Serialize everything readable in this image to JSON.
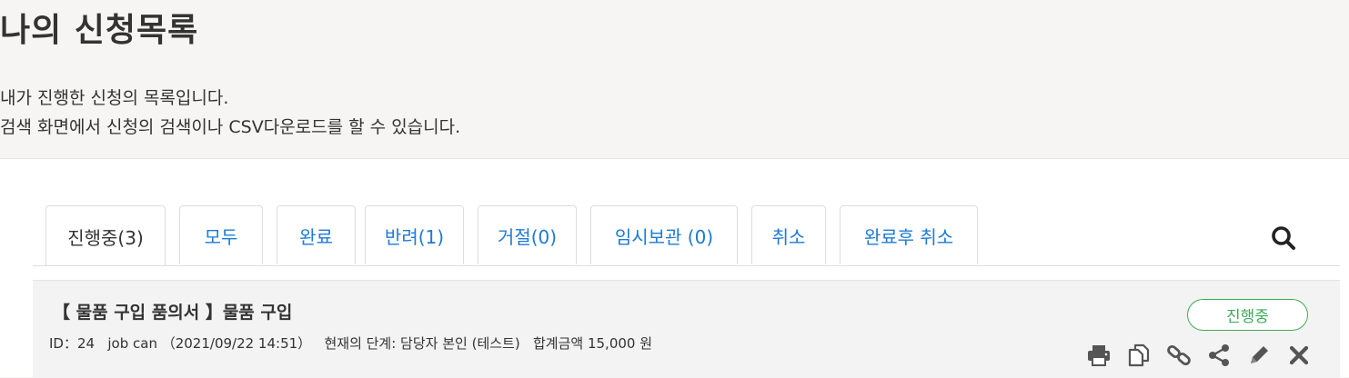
{
  "header": {
    "title": "나의 신청목록",
    "description_line1": "내가 진행한 신청의 목록입니다.",
    "description_line2": "검색 화면에서 신청의 검색이나 CSV다운로드를 할 수 있습니다."
  },
  "tabs": [
    {
      "label": "진행중(3)",
      "active": true
    },
    {
      "label": "모두",
      "active": false
    },
    {
      "label": "완료",
      "active": false
    },
    {
      "label": "반려(1)",
      "active": false
    },
    {
      "label": "거절(0)",
      "active": false
    },
    {
      "label": "임시보관 (0)",
      "active": false
    },
    {
      "label": "취소",
      "active": false
    },
    {
      "label": "완료후 취소",
      "active": false
    }
  ],
  "search": {
    "icon": "search-icon"
  },
  "requests": [
    {
      "title": "【 물품 구입 품의서 】물품 구입",
      "meta": "ID：24   job can （2021/09/22 14:51）   현재의 단계: 담당자 본인 (테스트)   합계금액 15,000 원",
      "status": "진행중"
    }
  ],
  "row_actions": [
    "print-icon",
    "copy-icon",
    "link-icon",
    "share-icon",
    "edit-icon",
    "delete-icon"
  ],
  "colors": {
    "accent": "#1e7ad6",
    "status_green": "#3dab5a",
    "text": "#333333",
    "background": "#f6f5f3"
  }
}
